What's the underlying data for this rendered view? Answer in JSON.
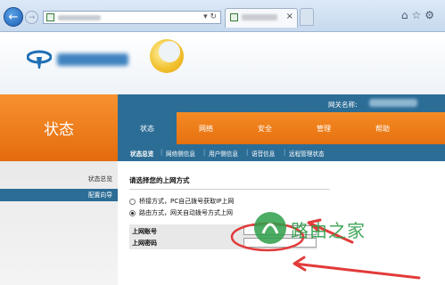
{
  "router": {
    "side_title": "状态",
    "gateway_label": "网关名称:",
    "menu": [
      {
        "label": "状态"
      },
      {
        "label": "网络"
      },
      {
        "label": "安全"
      },
      {
        "label": "管理"
      },
      {
        "label": "帮助"
      }
    ],
    "submenu": [
      "状态总览",
      "网络侧信息",
      "用户侧信息",
      "语音信息",
      "远程管理状态"
    ],
    "sidebar": [
      "状态总览",
      "配置向导"
    ]
  },
  "content": {
    "title": "请选择您的上网方式",
    "options": [
      {
        "label": "桥接方式，PC自己拨号获取IP上网",
        "checked": false
      },
      {
        "label": "路由方式，网关自动拨号方式上网",
        "checked": true
      }
    ],
    "fields": [
      {
        "label": "上网账号",
        "value": ""
      },
      {
        "label": "上网密码",
        "value": ""
      }
    ]
  },
  "watermark": {
    "text": "路由之家"
  },
  "colors": {
    "orange": "#f0801c",
    "blue": "#2c6d96",
    "annotation": "#e23b3b",
    "watermark": "#2e9f4a"
  },
  "icons": [
    "back-arrow-icon",
    "forward-arrow-icon",
    "favicon-icon",
    "close-icon",
    "home-icon",
    "star-icon",
    "gear-icon"
  ]
}
